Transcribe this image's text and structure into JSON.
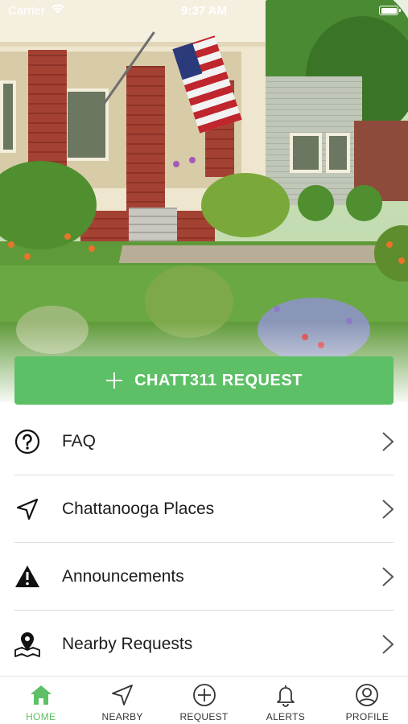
{
  "status_bar": {
    "carrier": "Carrier",
    "time": "9:37 AM",
    "wifi_icon": "wifi-icon",
    "battery_icon": "battery-icon"
  },
  "hero": {
    "image": "house-porch-garden-photo"
  },
  "request_button": {
    "label": "CHATT311 REQUEST",
    "icon": "plus-icon",
    "color": "#5dbf66"
  },
  "menu": {
    "items": [
      {
        "label": "FAQ",
        "icon": "question-circle-icon"
      },
      {
        "label": "Chattanooga Places",
        "icon": "navigation-arrow-icon"
      },
      {
        "label": "Announcements",
        "icon": "warning-triangle-icon"
      },
      {
        "label": "Nearby Requests",
        "icon": "map-pin-icon"
      }
    ],
    "chevron_icon": "chevron-right-icon"
  },
  "tab_bar": {
    "active_color": "#5dbf66",
    "tabs": [
      {
        "label": "HOME",
        "icon": "home-icon",
        "active": true
      },
      {
        "label": "NEARBY",
        "icon": "navigation-arrow-icon",
        "active": false
      },
      {
        "label": "REQUEST",
        "icon": "plus-circle-icon",
        "active": false
      },
      {
        "label": "ALERTS",
        "icon": "bell-icon",
        "active": false
      },
      {
        "label": "PROFILE",
        "icon": "user-circle-icon",
        "active": false
      }
    ]
  }
}
